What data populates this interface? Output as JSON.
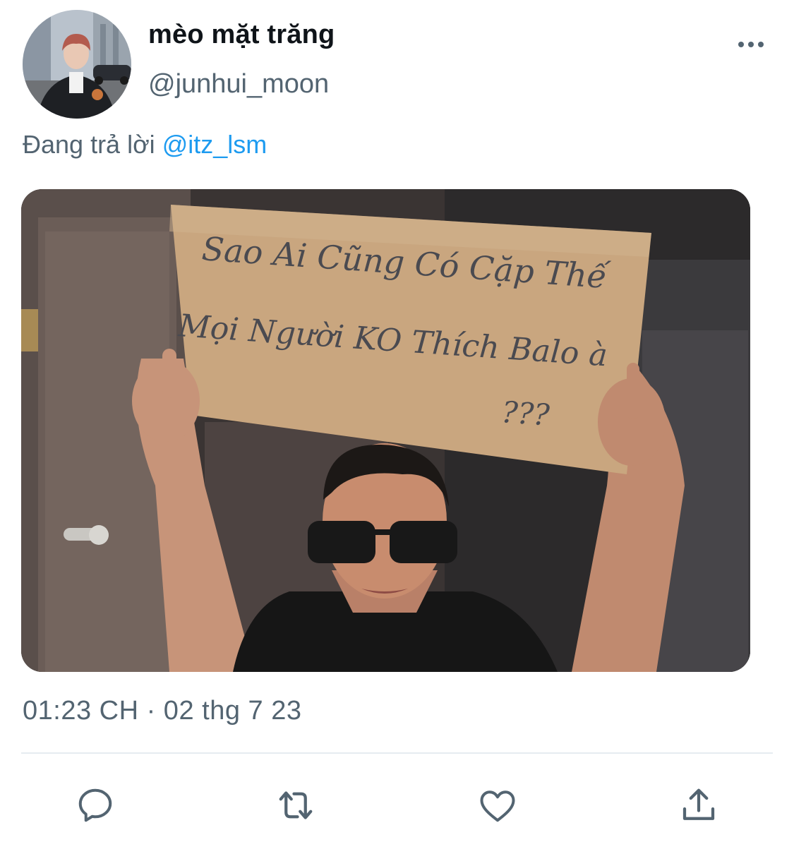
{
  "tweet": {
    "author": {
      "display_name": "mèo mặt trăng",
      "handle": "@junhui_moon",
      "avatar_icon": "avatar-photo"
    },
    "more_icon": "more-horizontal-icon",
    "reply": {
      "prefix": "Đang trả lời",
      "mention": "@itz_lsm"
    },
    "media": {
      "type": "photo",
      "sign_lines": [
        "Sao Ai Cũng Có Cặp Thế",
        "Mọi Người KO Thích Balo à",
        "???"
      ]
    },
    "timestamp": "01:23 CH · 02 thg 7 23"
  },
  "actions": [
    {
      "name": "reply",
      "icon": "reply-icon"
    },
    {
      "name": "retweet",
      "icon": "retweet-icon"
    },
    {
      "name": "like",
      "icon": "heart-icon"
    },
    {
      "name": "share",
      "icon": "share-icon"
    }
  ],
  "colors": {
    "text_primary": "#0f1419",
    "text_secondary": "#536471",
    "link": "#1d9bf0",
    "divider": "#e6ecf0"
  }
}
